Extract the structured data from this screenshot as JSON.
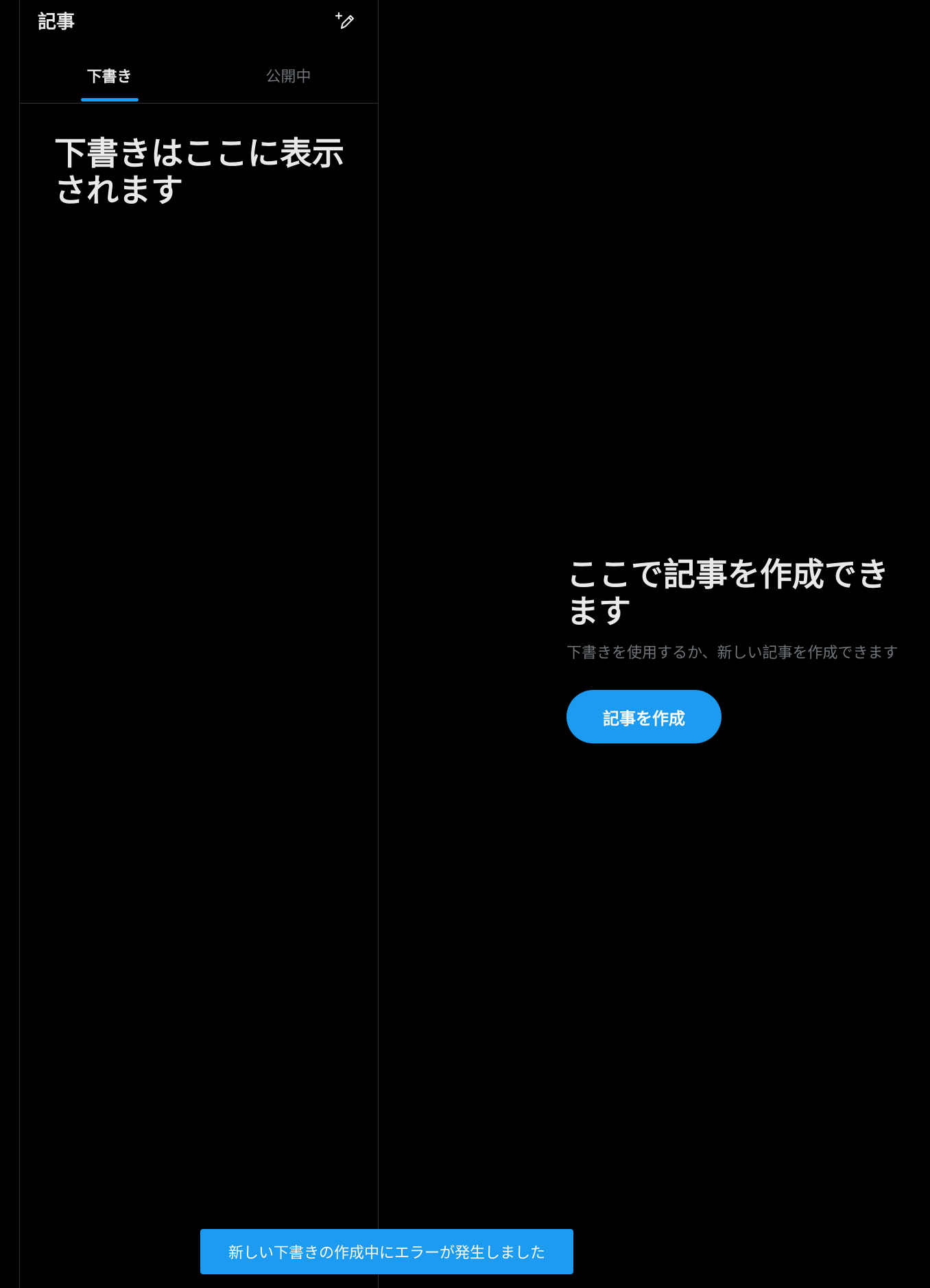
{
  "header": {
    "title": "記事",
    "compose_icon": "compose-pen-plus-icon"
  },
  "tabs": [
    {
      "label": "下書き",
      "active": true
    },
    {
      "label": "公開中",
      "active": false
    }
  ],
  "drafts_empty": {
    "title": "下書きはここに表示されます"
  },
  "main_empty": {
    "title": "ここで記事を作成できます",
    "subtitle": "下書きを使用するか、新しい記事を作成できます",
    "button_label": "記事を作成"
  },
  "toast": {
    "message": "新しい下書きの作成中にエラーが発生しました"
  },
  "colors": {
    "accent": "#1d9bf0",
    "background": "#000000",
    "primary_text": "#e7e9ea",
    "secondary_text": "#71767b",
    "border": "#2f3336"
  }
}
